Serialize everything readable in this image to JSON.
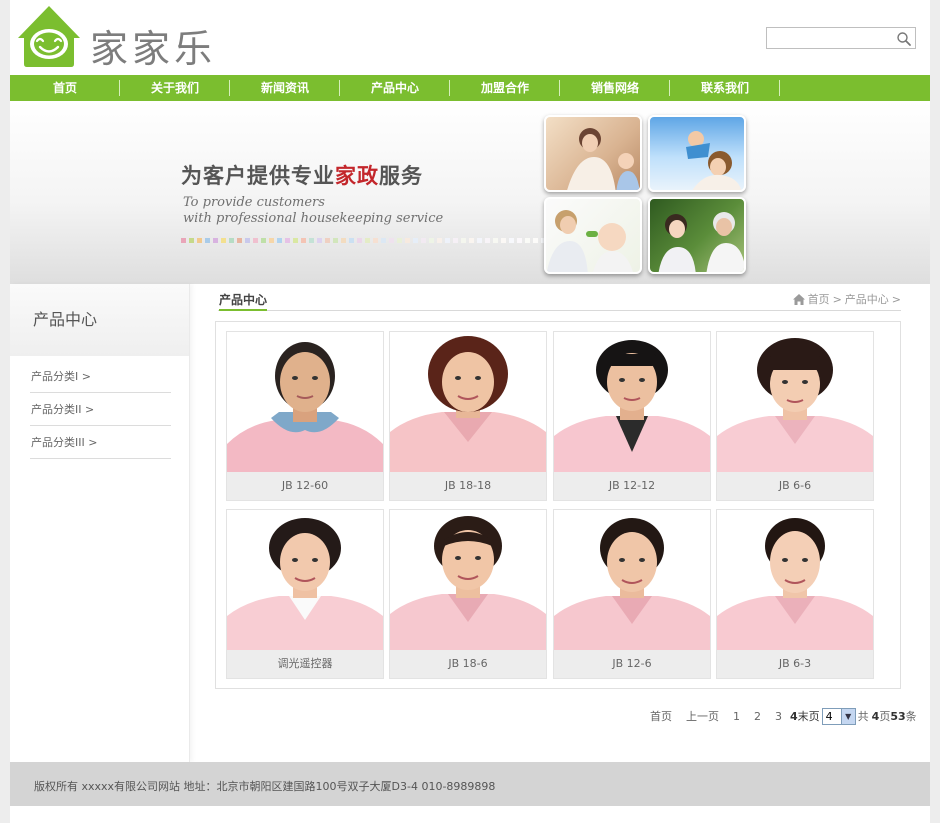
{
  "header": {
    "logo_text": "家家乐",
    "search": {
      "value": "",
      "placeholder": ""
    },
    "icons": {
      "logo": "smiling-house-logo",
      "search": "magnifier-icon"
    }
  },
  "nav": {
    "items": [
      "首页",
      "关于我们",
      "新闻资讯",
      "产品中心",
      "加盟合作",
      "销售网络",
      "联系我们"
    ]
  },
  "banner": {
    "title_before": "为客户提供专业",
    "title_highlight": "家政",
    "title_after": "服务",
    "subtitle_line1": "To provide customers",
    "subtitle_line2": "with professional housekeeping service",
    "accent_color": "#c3262b"
  },
  "sidebar": {
    "title": "产品中心",
    "items": [
      "产品分类I  >",
      "产品分类II  >",
      "产品分类III  >"
    ]
  },
  "content": {
    "title": "产品中心",
    "breadcrumb": [
      "首页",
      ">",
      "产品中心",
      ">"
    ]
  },
  "products": [
    {
      "caption": "JB 12-60"
    },
    {
      "caption": "JB 18-18"
    },
    {
      "caption": "JB 12-12"
    },
    {
      "caption": "JB 6-6"
    },
    {
      "caption": "调光遥控器"
    },
    {
      "caption": "JB 18-6"
    },
    {
      "caption": "JB 12-6"
    },
    {
      "caption": "JB 6-3"
    }
  ],
  "pager": {
    "first": "首页",
    "prev": "上一页",
    "pages": [
      "1",
      "2",
      "3"
    ],
    "current": "4",
    "last": "末页",
    "select_value": "4",
    "total_prefix": "共",
    "total_pages": "4",
    "pages_unit": "页",
    "total_items": "53",
    "items_unit": "条"
  },
  "footer": {
    "text": "版权所有 xxxxx有限公司网站 地址：北京市朝阳区建国路100号双子大厦D3-4 010-8989898"
  },
  "colors": {
    "brand_green": "#7bbe2f",
    "footer_bg": "#d4d4d4"
  }
}
